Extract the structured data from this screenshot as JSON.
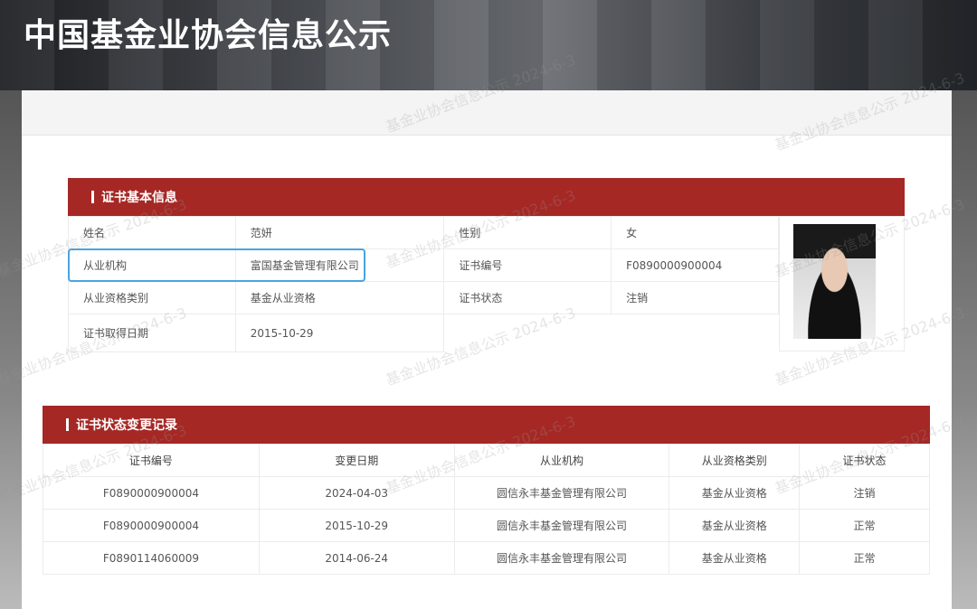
{
  "header": {
    "title": "中国基金业协会信息公示"
  },
  "watermark": "基金业协会信息公示 2024-6-3",
  "basic": {
    "title": "证书基本信息",
    "rows": [
      [
        "姓名",
        "范妍",
        "性别",
        "女"
      ],
      [
        "从业机构",
        "富国基金管理有限公司",
        "证书编号",
        "F0890000900004"
      ],
      [
        "从业资格类别",
        "基金从业资格",
        "证书状态",
        "注销"
      ],
      [
        "证书取得日期",
        "2015-10-29",
        "",
        ""
      ]
    ]
  },
  "history": {
    "title": "证书状态变更记录",
    "columns": [
      "证书编号",
      "变更日期",
      "从业机构",
      "从业资格类别",
      "证书状态"
    ],
    "rows": [
      [
        "F0890000900004",
        "2024-04-03",
        "圆信永丰基金管理有限公司",
        "基金从业资格",
        "注销"
      ],
      [
        "F0890000900004",
        "2015-10-29",
        "圆信永丰基金管理有限公司",
        "基金从业资格",
        "正常"
      ],
      [
        "F0890114060009",
        "2014-06-24",
        "圆信永丰基金管理有限公司",
        "基金从业资格",
        "正常"
      ]
    ]
  },
  "colors": {
    "accent": "#a52825",
    "highlight": "#4aa3e0"
  }
}
